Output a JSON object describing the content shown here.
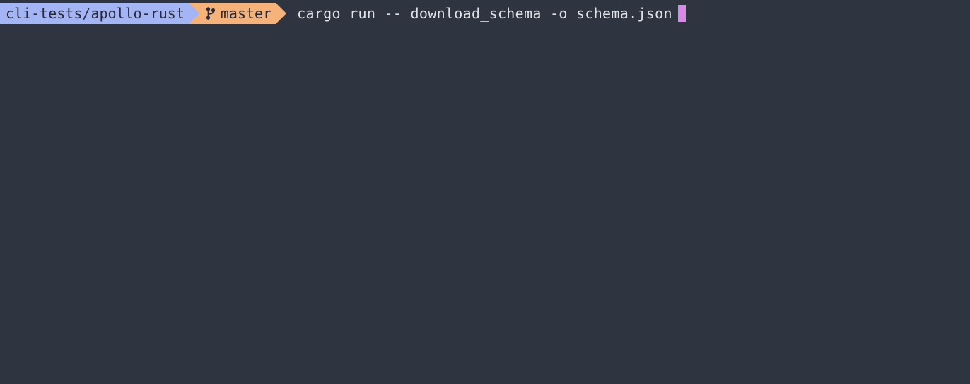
{
  "prompt": {
    "path": "cli-tests/apollo-rust",
    "branch": "master",
    "command": "cargo run -- download_schema -o schema.json"
  },
  "colors": {
    "background": "#2e3440",
    "path_bg": "#a3b5f5",
    "branch_bg": "#f5b37a",
    "text_dark": "#2a2a3a",
    "text_light": "#e0e2e8",
    "cursor": "#d88ae8"
  }
}
